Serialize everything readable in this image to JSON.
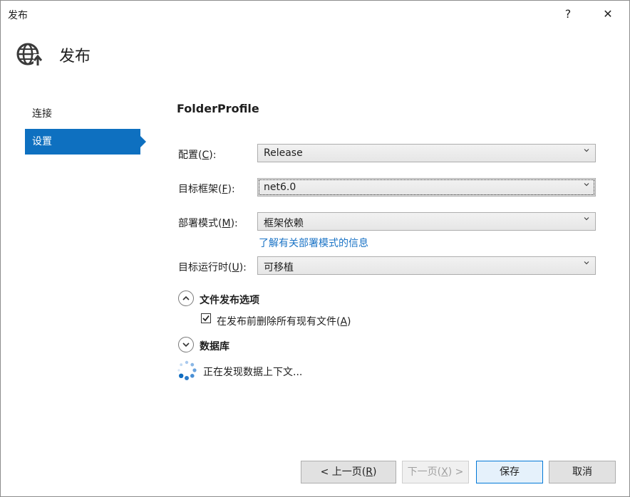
{
  "window": {
    "title": "发布",
    "help": "?",
    "close": "✕"
  },
  "header": {
    "title": "发布",
    "icon": "globe-publish-icon"
  },
  "sidebar": {
    "items": [
      {
        "label": "连接"
      },
      {
        "label": "设置"
      }
    ]
  },
  "main": {
    "profile_name": "FolderProfile",
    "fields": {
      "config": {
        "label_pre": "配置(",
        "mnemonic": "C",
        "label_post": "):",
        "value": "Release"
      },
      "framework": {
        "label_pre": "目标框架(",
        "mnemonic": "F",
        "label_post": "):",
        "value": "net6.0"
      },
      "deploy_mode": {
        "label_pre": "部署模式(",
        "mnemonic": "M",
        "label_post": "):",
        "value": "框架依赖"
      },
      "runtime": {
        "label_pre": "目标运行时(",
        "mnemonic": "U",
        "label_post": "):",
        "value": "可移植"
      }
    },
    "deploy_mode_link": "了解有关部署模式的信息",
    "file_options": {
      "title": "文件发布选项",
      "checkbox": {
        "label_pre": "在发布前删除所有现有文件(",
        "mnemonic": "A",
        "label_post": ")",
        "checked": true
      }
    },
    "database": {
      "title": "数据库",
      "status": "正在发现数据上下文..."
    }
  },
  "footer": {
    "prev": {
      "pre": "< 上一页(",
      "mnemonic": "R",
      "post": ")"
    },
    "next": {
      "pre": "下一页(",
      "mnemonic": "X",
      "post": ") >"
    },
    "save": "保存",
    "cancel": "取消"
  },
  "colors": {
    "accent": "#0e70c0",
    "link": "#1a73c6"
  }
}
